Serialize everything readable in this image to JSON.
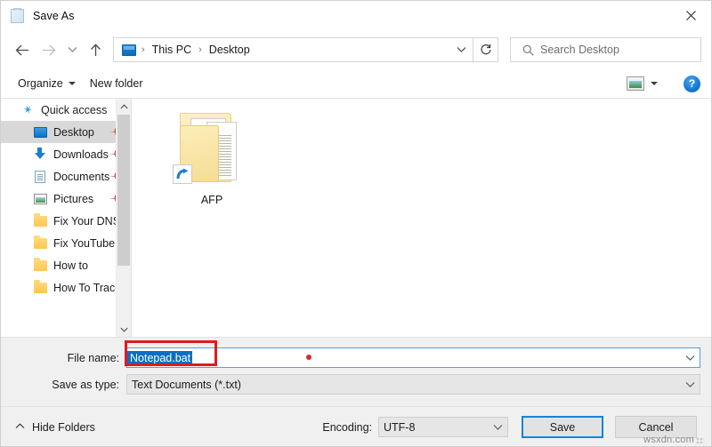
{
  "window": {
    "title": "Save As",
    "app_icon": "notepad-icon",
    "close_label": "✕"
  },
  "nav": {
    "back": "←",
    "forward": "→",
    "recent_chevron": "⌄",
    "up": "↑",
    "refresh": "↻",
    "address_chevron": "⌄",
    "breadcrumbs": [
      "This PC",
      "Desktop"
    ],
    "separator": "›"
  },
  "search": {
    "placeholder": "Search Desktop",
    "icon": "search-icon"
  },
  "command_bar": {
    "organize": "Organize",
    "new_folder": "New folder",
    "view_icon": "picture-view-icon",
    "help": "?"
  },
  "sidebar": {
    "items": [
      {
        "label": "Quick access",
        "icon": "star-icon",
        "selected": false,
        "pinned": false,
        "indent": false
      },
      {
        "label": "Desktop",
        "icon": "monitor-icon",
        "selected": true,
        "pinned": true,
        "indent": true
      },
      {
        "label": "Downloads",
        "icon": "download-icon",
        "selected": false,
        "pinned": true,
        "indent": true
      },
      {
        "label": "Documents",
        "icon": "document-icon",
        "selected": false,
        "pinned": true,
        "indent": true
      },
      {
        "label": "Pictures",
        "icon": "pictures-icon",
        "selected": false,
        "pinned": true,
        "indent": true
      },
      {
        "label": "Fix Your DNS Ser",
        "icon": "folder-icon",
        "selected": false,
        "pinned": false,
        "indent": true
      },
      {
        "label": "Fix YouTube Blac",
        "icon": "folder-icon",
        "selected": false,
        "pinned": false,
        "indent": true
      },
      {
        "label": "How to",
        "icon": "folder-icon",
        "selected": false,
        "pinned": false,
        "indent": true
      },
      {
        "label": "How To Trace Th",
        "icon": "folder-icon",
        "selected": false,
        "pinned": false,
        "indent": true
      }
    ],
    "scroll_up": "⌃",
    "scroll_down": "⌄"
  },
  "files": {
    "items": [
      {
        "label": "AFP",
        "icon": "folder-shortcut-icon",
        "shortcut_arrow": "↗"
      }
    ]
  },
  "form": {
    "file_name_label": "File name:",
    "file_name_value": "Notepad.bat",
    "save_as_type_label": "Save as type:",
    "save_as_type_value": "Text Documents (*.txt)",
    "dropdown_chevron": "⌄"
  },
  "footer": {
    "hide_folders": "Hide Folders",
    "hide_folders_chevron": "⌃",
    "encoding_label": "Encoding:",
    "encoding_value": "UTF-8",
    "save_button": "Save",
    "cancel_button": "Cancel"
  },
  "watermark": {
    "text": "wsxdn.com"
  },
  "colors": {
    "accent": "#0a6fc2",
    "focus_border": "#1a82d8",
    "annotation_red": "#e01b1b",
    "selected_row": "#d8d8d8"
  }
}
